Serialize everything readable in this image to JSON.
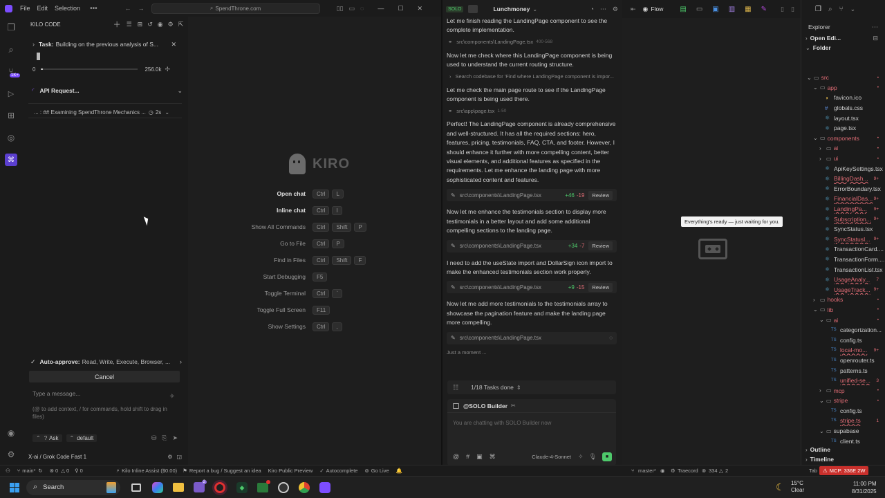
{
  "titlebar": {
    "menus": [
      "File",
      "Edit",
      "Selection"
    ],
    "search": "SpendThrone.com"
  },
  "kilo": {
    "title": "KILO CODE",
    "task_label": "Task:",
    "task_text": "Building on the previous analysis of S...",
    "progress_min": "0",
    "progress_max": "256.0k",
    "api_request": "API Request...",
    "examining": "... : ## Examining SpendThrone Mechanics ...",
    "examining_time": "2s",
    "auto_approve_label": "Auto-approve:",
    "auto_approve_value": "Read, Write, Execute, Browser, ...",
    "cancel": "Cancel",
    "msg_placeholder": "Type a message...",
    "msg_hint": "(@ to add context, / for commands, hold shift to drag in files)",
    "mode": "Ask",
    "profile": "default",
    "model": "X-ai / Grok Code Fast 1"
  },
  "welcome": {
    "brand": "KIRO",
    "commands": [
      {
        "label": "Open chat",
        "keys": [
          "Ctrl",
          "L"
        ]
      },
      {
        "label": "Inline chat",
        "keys": [
          "Ctrl",
          "I"
        ]
      },
      {
        "label": "Show All Commands",
        "keys": [
          "Ctrl",
          "Shift",
          "P"
        ]
      },
      {
        "label": "Go to File",
        "keys": [
          "Ctrl",
          "P"
        ]
      },
      {
        "label": "Find in Files",
        "keys": [
          "Ctrl",
          "Shift",
          "F"
        ]
      },
      {
        "label": "Start Debugging",
        "keys": [
          "F5"
        ]
      },
      {
        "label": "Toggle Terminal",
        "keys": [
          "Ctrl",
          "`"
        ]
      },
      {
        "label": "Toggle Full Screen",
        "keys": [
          "F11"
        ]
      },
      {
        "label": "Show Settings",
        "keys": [
          "Ctrl",
          ","
        ]
      }
    ]
  },
  "chat": {
    "header_badge": "SOLO",
    "project": "Lunchmoney",
    "messages": [
      {
        "text": "Let me finish reading the LandingPage component to see the complete implementation.",
        "ref": "src\\components\\LandingPage.tsx",
        "ref_range": "400-568"
      },
      {
        "text": "Now let me check where this LandingPage component is being used to understand the current routing structure.",
        "ref": "Search codebase for 'Find where LandingPage component is impor..."
      },
      {
        "text": "Let me check the main page route to see if the LandingPage component is being used there.",
        "ref": "src\\app\\page.tsx",
        "ref_range": "1-50"
      },
      {
        "text": "Perfect! The LandingPage component is already comprehensive and well-structured. It has all the required sections: hero, features, pricing, testimonials, FAQ, CTA, and footer. However, I should enhance it further with more compelling content, better visual elements, and additional features as specified in the requirements. Let me enhance the landing page with more sophisticated content and features.",
        "file": "src\\components\\LandingPage.tsx",
        "add": "+46",
        "del": "-19"
      },
      {
        "text": "Now let me enhance the testimonials section to display more testimonials in a better layout and add some additional compelling sections to the landing page.",
        "file": "src\\components\\LandingPage.tsx",
        "add": "+34",
        "del": "-7"
      },
      {
        "text": "I need to add the useState import and DollarSign icon import to make the enhanced testimonials section work properly.",
        "file": "src\\components\\LandingPage.tsx",
        "add": "+9",
        "del": "-15"
      },
      {
        "text": "Now let me add more testimonials to the testimonials array to showcase the pagination feature and make the landing page more compelling.",
        "file": "src\\components\\LandingPage.tsx"
      }
    ],
    "review": "Review",
    "just_a_moment": "Just a moment ...",
    "tasks_done": "1/18 Tasks done",
    "builder": "@SOLO Builder",
    "input_placeholder": "You are chatting with SOLO Builder now",
    "model": "Claude-4-Sonnet"
  },
  "flow": {
    "label": "Flow",
    "tooltip": "Everything's ready — just waiting for you."
  },
  "explorer": {
    "title": "Explorer",
    "open_editors": "Open Edi...",
    "folder": "Folder",
    "tree": [
      {
        "name": "src",
        "indent": 0,
        "type": "folder-open",
        "color": "#e06c75",
        "badge": "•"
      },
      {
        "name": "app",
        "indent": 1,
        "type": "folder-open",
        "color": "#e06c75",
        "badge": "•"
      },
      {
        "name": "favicon.ico",
        "indent": 2,
        "type": "file",
        "color": "#cccccc",
        "icon": "ico"
      },
      {
        "name": "globals.css",
        "indent": 2,
        "type": "file",
        "color": "#cccccc",
        "icon": "css"
      },
      {
        "name": "layout.tsx",
        "indent": 2,
        "type": "file",
        "color": "#cccccc",
        "icon": "tsx"
      },
      {
        "name": "page.tsx",
        "indent": 2,
        "type": "file",
        "color": "#cccccc",
        "icon": "tsx"
      },
      {
        "name": "components",
        "indent": 1,
        "type": "folder-open",
        "color": "#e06c75",
        "badge": "•"
      },
      {
        "name": "ai",
        "indent": 2,
        "type": "folder",
        "color": "#e06c75",
        "badge": "•"
      },
      {
        "name": "ui",
        "indent": 2,
        "type": "folder",
        "color": "#e06c75",
        "badge": "•"
      },
      {
        "name": "ApiKeySettings.tsx",
        "indent": 2,
        "type": "file",
        "color": "#cccccc",
        "icon": "tsx"
      },
      {
        "name": "BillingDash...",
        "indent": 2,
        "type": "file",
        "color": "#e06c75",
        "icon": "tsx",
        "badge": "9+"
      },
      {
        "name": "ErrorBoundary.tsx",
        "indent": 2,
        "type": "file",
        "color": "#cccccc",
        "icon": "tsx"
      },
      {
        "name": "FinancialDas...",
        "indent": 2,
        "type": "file",
        "color": "#e06c75",
        "icon": "tsx",
        "badge": "9+"
      },
      {
        "name": "LandingPa...",
        "indent": 2,
        "type": "file",
        "color": "#e06c75",
        "icon": "tsx",
        "badge": "9+"
      },
      {
        "name": "Subscription...",
        "indent": 2,
        "type": "file",
        "color": "#e06c75",
        "icon": "tsx",
        "badge": "9+"
      },
      {
        "name": "SyncStatus.tsx",
        "indent": 2,
        "type": "file",
        "color": "#cccccc",
        "icon": "tsx"
      },
      {
        "name": "SyncStatusI...",
        "indent": 2,
        "type": "file",
        "color": "#e06c75",
        "icon": "tsx",
        "badge": "9+"
      },
      {
        "name": "TransactionCard....",
        "indent": 2,
        "type": "file",
        "color": "#cccccc",
        "icon": "tsx"
      },
      {
        "name": "TransactionForm....",
        "indent": 2,
        "type": "file",
        "color": "#cccccc",
        "icon": "tsx"
      },
      {
        "name": "TransactionList.tsx",
        "indent": 2,
        "type": "file",
        "color": "#cccccc",
        "icon": "tsx"
      },
      {
        "name": "UsageAnaly...",
        "indent": 2,
        "type": "file",
        "color": "#e06c75",
        "icon": "tsx",
        "badge": "7"
      },
      {
        "name": "UsageTrack...",
        "indent": 2,
        "type": "file",
        "color": "#e06c75",
        "icon": "tsx",
        "badge": "9+"
      },
      {
        "name": "hooks",
        "indent": 1,
        "type": "folder",
        "color": "#e06c75",
        "badge": "•"
      },
      {
        "name": "lib",
        "indent": 1,
        "type": "folder-open",
        "color": "#e06c75",
        "badge": "•"
      },
      {
        "name": "ai",
        "indent": 2,
        "type": "folder-open",
        "color": "#e06c75",
        "badge": "•"
      },
      {
        "name": "categorization...",
        "indent": 3,
        "type": "file",
        "color": "#cccccc",
        "icon": "TS"
      },
      {
        "name": "config.ts",
        "indent": 3,
        "type": "file",
        "color": "#cccccc",
        "icon": "TS"
      },
      {
        "name": "local-mo...",
        "indent": 3,
        "type": "file",
        "color": "#e06c75",
        "icon": "TS",
        "badge": "9+"
      },
      {
        "name": "openrouter.ts",
        "indent": 3,
        "type": "file",
        "color": "#cccccc",
        "icon": "TS"
      },
      {
        "name": "patterns.ts",
        "indent": 3,
        "type": "file",
        "color": "#cccccc",
        "icon": "TS"
      },
      {
        "name": "unified-se...",
        "indent": 3,
        "type": "file",
        "color": "#e06c75",
        "icon": "TS",
        "badge": "3"
      },
      {
        "name": "mcp",
        "indent": 2,
        "type": "folder",
        "color": "#e06c75",
        "badge": "•"
      },
      {
        "name": "stripe",
        "indent": 2,
        "type": "folder-open",
        "color": "#e06c75",
        "badge": "•"
      },
      {
        "name": "config.ts",
        "indent": 3,
        "type": "file",
        "color": "#cccccc",
        "icon": "TS"
      },
      {
        "name": "stripe.ts",
        "indent": 3,
        "type": "file",
        "color": "#e06c75",
        "icon": "TS",
        "badge": "1"
      },
      {
        "name": "supabase",
        "indent": 2,
        "type": "folder-open",
        "color": "#cccccc"
      },
      {
        "name": "client.ts",
        "indent": 3,
        "type": "file",
        "color": "#cccccc",
        "icon": "TS"
      }
    ],
    "outline": "Outline",
    "timeline": "Timeline"
  },
  "statusbar": {
    "branch": "main*",
    "errors": "0",
    "warnings": "0",
    "ports": "0",
    "kilo_inline": "Kilo Inline Assist ($0.00)",
    "report": "Report a bug / Suggest an idea",
    "kiro_preview": "Kiro Public Preview",
    "autocomplete": "Autocomplete",
    "go_live": "Go Live",
    "branch2": "master*",
    "traecord": "Traecord",
    "count1": "334",
    "count2": "2",
    "tab": "Tab",
    "mcp": "MCP: 336E 2W"
  },
  "taskbar": {
    "search": "Search",
    "weather_temp": "15°C",
    "weather_desc": "Clear",
    "time": "11:00 PM",
    "date": "8/31/2025"
  },
  "colors": {
    "accent_purple": "#8b5cf6",
    "green": "#4ec96b",
    "red": "#e06c75",
    "mcp_red": "#c9302c"
  }
}
